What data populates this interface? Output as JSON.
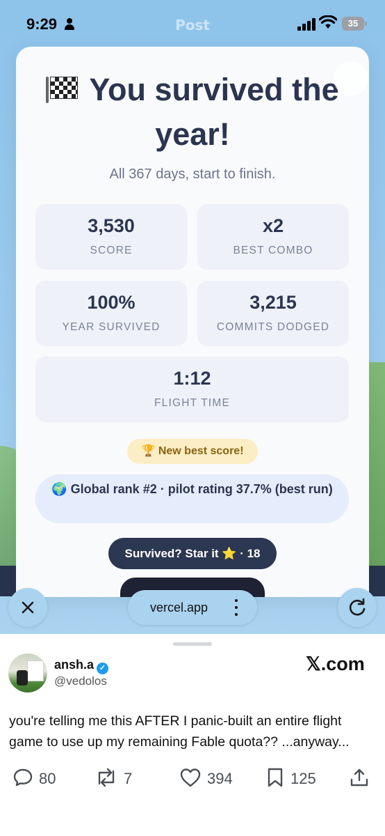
{
  "status_bar": {
    "time": "9:29",
    "battery": "35"
  },
  "page": {
    "header_ghost": "Post"
  },
  "card": {
    "title": "You survived the year!",
    "subtitle": "All 367 days, start to finish.",
    "stats": [
      {
        "value": "3,530",
        "label": "SCORE"
      },
      {
        "value": "x2",
        "label": "BEST COMBO"
      },
      {
        "value": "100%",
        "label": "YEAR SURVIVED"
      },
      {
        "value": "3,215",
        "label": "COMMITS DODGED"
      },
      {
        "value": "1:12",
        "label": "FLIGHT TIME"
      }
    ],
    "best_badge": "🏆 New best score!",
    "rank": {
      "globe": "🌍",
      "prefix": "Global rank",
      "rank_value": "#2",
      "middle": "· pilot rating",
      "rating": "37.7%",
      "suffix": "(best run)"
    },
    "star_button": "Survived? Star it ⭐ · 18"
  },
  "browser": {
    "url": "vercel.app",
    "close_icon": "close-icon",
    "refresh_icon": "refresh-icon"
  },
  "tweet": {
    "author_name": "ansh.a",
    "author_handle": "@vedolos",
    "source": "𝕏.com",
    "text": "you're telling me this AFTER I panic-built an entire flight game to use up my remaining Fable quota?? ...anyway...",
    "replies": "80",
    "reposts": "7",
    "likes": "394",
    "bookmarks": "125"
  },
  "colors": {
    "accent": "#2c3751",
    "sky": "#9ccbee",
    "badge": "#fbeec4",
    "verified": "#1d9bf0"
  }
}
